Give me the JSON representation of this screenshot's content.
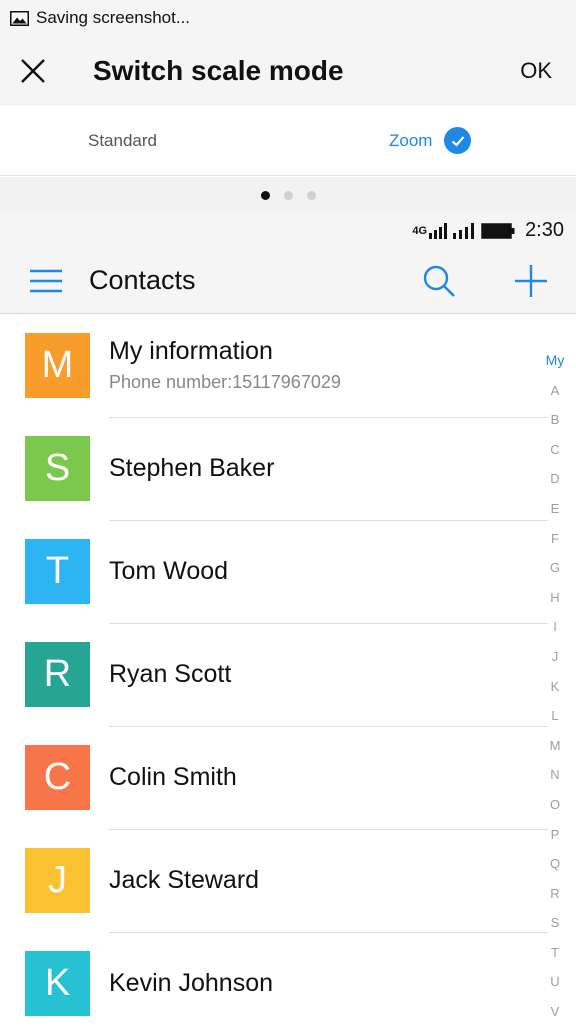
{
  "notification": {
    "text": "Saving screenshot...",
    "icon": "image-icon"
  },
  "scale_header": {
    "title": "Switch scale mode",
    "ok_label": "OK",
    "close_icon": "close-icon"
  },
  "modes": {
    "standard_label": "Standard",
    "zoom_label": "Zoom",
    "selected": "Zoom",
    "accent": "#1e88e5"
  },
  "pager": {
    "pages": 3,
    "active_index": 0
  },
  "phone_status": {
    "network_label": "4G",
    "time": "2:30"
  },
  "app_bar": {
    "title": "Contacts",
    "menu_icon": "menu-icon",
    "search_icon": "search-icon",
    "add_icon": "plus-icon"
  },
  "contacts": [
    {
      "initial": "M",
      "name": "My information",
      "sub": "Phone number:15117967029",
      "color": "#f89c2b"
    },
    {
      "initial": "S",
      "name": "Stephen Baker",
      "sub": "",
      "color": "#7cc84d"
    },
    {
      "initial": "T",
      "name": "Tom Wood",
      "sub": "",
      "color": "#2cb4f3"
    },
    {
      "initial": "R",
      "name": "Ryan Scott",
      "sub": "",
      "color": "#26a595"
    },
    {
      "initial": "C",
      "name": "Colin Smith",
      "sub": "",
      "color": "#f8754a"
    },
    {
      "initial": "J",
      "name": "Jack Steward",
      "sub": "",
      "color": "#fbc130"
    },
    {
      "initial": "K",
      "name": "Kevin Johnson",
      "sub": "",
      "color": "#26c2d3"
    }
  ],
  "alpha_index": [
    "My",
    "A",
    "B",
    "C",
    "D",
    "E",
    "F",
    "G",
    "H",
    "I",
    "J",
    "K",
    "L",
    "M",
    "N",
    "O",
    "P",
    "Q",
    "R",
    "S",
    "T",
    "U",
    "V"
  ]
}
